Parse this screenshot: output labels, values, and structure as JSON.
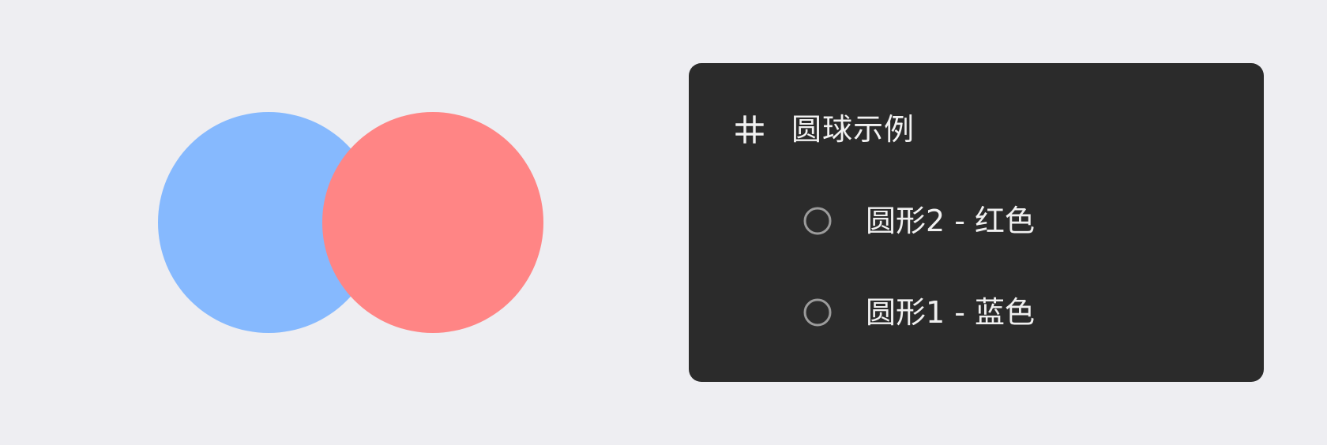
{
  "canvas": {
    "shapes": [
      {
        "name": "圆形1",
        "color": "#86b9fe"
      },
      {
        "name": "圆形2",
        "color": "#ff8585"
      }
    ]
  },
  "layers_panel": {
    "background": "#2b2b2b",
    "group": {
      "icon": "frame-hash-icon",
      "label": "圆球示例"
    },
    "layers": [
      {
        "icon": "circle-outline-icon",
        "label": "圆形2 - 红色"
      },
      {
        "icon": "circle-outline-icon",
        "label": "圆形1 - 蓝色"
      }
    ]
  }
}
